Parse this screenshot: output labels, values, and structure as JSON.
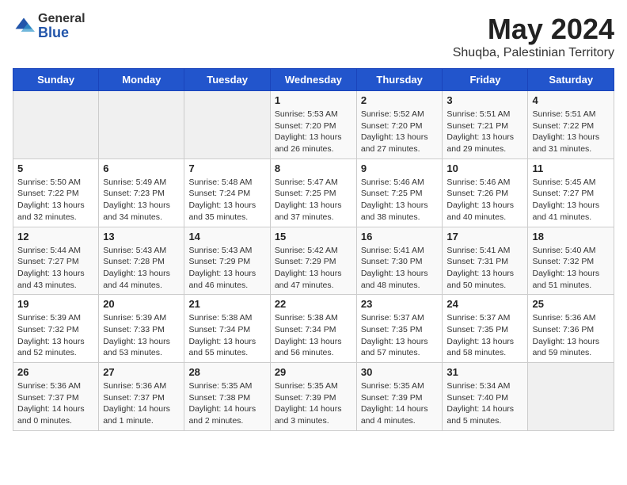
{
  "logo": {
    "general": "General",
    "blue": "Blue"
  },
  "title": "May 2024",
  "subtitle": "Shuqba, Palestinian Territory",
  "weekdays": [
    "Sunday",
    "Monday",
    "Tuesday",
    "Wednesday",
    "Thursday",
    "Friday",
    "Saturday"
  ],
  "weeks": [
    [
      null,
      null,
      null,
      {
        "day": "1",
        "sunrise": "Sunrise: 5:53 AM",
        "sunset": "Sunset: 7:20 PM",
        "daylight": "Daylight: 13 hours and 26 minutes."
      },
      {
        "day": "2",
        "sunrise": "Sunrise: 5:52 AM",
        "sunset": "Sunset: 7:20 PM",
        "daylight": "Daylight: 13 hours and 27 minutes."
      },
      {
        "day": "3",
        "sunrise": "Sunrise: 5:51 AM",
        "sunset": "Sunset: 7:21 PM",
        "daylight": "Daylight: 13 hours and 29 minutes."
      },
      {
        "day": "4",
        "sunrise": "Sunrise: 5:51 AM",
        "sunset": "Sunset: 7:22 PM",
        "daylight": "Daylight: 13 hours and 31 minutes."
      }
    ],
    [
      {
        "day": "5",
        "sunrise": "Sunrise: 5:50 AM",
        "sunset": "Sunset: 7:22 PM",
        "daylight": "Daylight: 13 hours and 32 minutes."
      },
      {
        "day": "6",
        "sunrise": "Sunrise: 5:49 AM",
        "sunset": "Sunset: 7:23 PM",
        "daylight": "Daylight: 13 hours and 34 minutes."
      },
      {
        "day": "7",
        "sunrise": "Sunrise: 5:48 AM",
        "sunset": "Sunset: 7:24 PM",
        "daylight": "Daylight: 13 hours and 35 minutes."
      },
      {
        "day": "8",
        "sunrise": "Sunrise: 5:47 AM",
        "sunset": "Sunset: 7:25 PM",
        "daylight": "Daylight: 13 hours and 37 minutes."
      },
      {
        "day": "9",
        "sunrise": "Sunrise: 5:46 AM",
        "sunset": "Sunset: 7:25 PM",
        "daylight": "Daylight: 13 hours and 38 minutes."
      },
      {
        "day": "10",
        "sunrise": "Sunrise: 5:46 AM",
        "sunset": "Sunset: 7:26 PM",
        "daylight": "Daylight: 13 hours and 40 minutes."
      },
      {
        "day": "11",
        "sunrise": "Sunrise: 5:45 AM",
        "sunset": "Sunset: 7:27 PM",
        "daylight": "Daylight: 13 hours and 41 minutes."
      }
    ],
    [
      {
        "day": "12",
        "sunrise": "Sunrise: 5:44 AM",
        "sunset": "Sunset: 7:27 PM",
        "daylight": "Daylight: 13 hours and 43 minutes."
      },
      {
        "day": "13",
        "sunrise": "Sunrise: 5:43 AM",
        "sunset": "Sunset: 7:28 PM",
        "daylight": "Daylight: 13 hours and 44 minutes."
      },
      {
        "day": "14",
        "sunrise": "Sunrise: 5:43 AM",
        "sunset": "Sunset: 7:29 PM",
        "daylight": "Daylight: 13 hours and 46 minutes."
      },
      {
        "day": "15",
        "sunrise": "Sunrise: 5:42 AM",
        "sunset": "Sunset: 7:29 PM",
        "daylight": "Daylight: 13 hours and 47 minutes."
      },
      {
        "day": "16",
        "sunrise": "Sunrise: 5:41 AM",
        "sunset": "Sunset: 7:30 PM",
        "daylight": "Daylight: 13 hours and 48 minutes."
      },
      {
        "day": "17",
        "sunrise": "Sunrise: 5:41 AM",
        "sunset": "Sunset: 7:31 PM",
        "daylight": "Daylight: 13 hours and 50 minutes."
      },
      {
        "day": "18",
        "sunrise": "Sunrise: 5:40 AM",
        "sunset": "Sunset: 7:32 PM",
        "daylight": "Daylight: 13 hours and 51 minutes."
      }
    ],
    [
      {
        "day": "19",
        "sunrise": "Sunrise: 5:39 AM",
        "sunset": "Sunset: 7:32 PM",
        "daylight": "Daylight: 13 hours and 52 minutes."
      },
      {
        "day": "20",
        "sunrise": "Sunrise: 5:39 AM",
        "sunset": "Sunset: 7:33 PM",
        "daylight": "Daylight: 13 hours and 53 minutes."
      },
      {
        "day": "21",
        "sunrise": "Sunrise: 5:38 AM",
        "sunset": "Sunset: 7:34 PM",
        "daylight": "Daylight: 13 hours and 55 minutes."
      },
      {
        "day": "22",
        "sunrise": "Sunrise: 5:38 AM",
        "sunset": "Sunset: 7:34 PM",
        "daylight": "Daylight: 13 hours and 56 minutes."
      },
      {
        "day": "23",
        "sunrise": "Sunrise: 5:37 AM",
        "sunset": "Sunset: 7:35 PM",
        "daylight": "Daylight: 13 hours and 57 minutes."
      },
      {
        "day": "24",
        "sunrise": "Sunrise: 5:37 AM",
        "sunset": "Sunset: 7:35 PM",
        "daylight": "Daylight: 13 hours and 58 minutes."
      },
      {
        "day": "25",
        "sunrise": "Sunrise: 5:36 AM",
        "sunset": "Sunset: 7:36 PM",
        "daylight": "Daylight: 13 hours and 59 minutes."
      }
    ],
    [
      {
        "day": "26",
        "sunrise": "Sunrise: 5:36 AM",
        "sunset": "Sunset: 7:37 PM",
        "daylight": "Daylight: 14 hours and 0 minutes."
      },
      {
        "day": "27",
        "sunrise": "Sunrise: 5:36 AM",
        "sunset": "Sunset: 7:37 PM",
        "daylight": "Daylight: 14 hours and 1 minute."
      },
      {
        "day": "28",
        "sunrise": "Sunrise: 5:35 AM",
        "sunset": "Sunset: 7:38 PM",
        "daylight": "Daylight: 14 hours and 2 minutes."
      },
      {
        "day": "29",
        "sunrise": "Sunrise: 5:35 AM",
        "sunset": "Sunset: 7:39 PM",
        "daylight": "Daylight: 14 hours and 3 minutes."
      },
      {
        "day": "30",
        "sunrise": "Sunrise: 5:35 AM",
        "sunset": "Sunset: 7:39 PM",
        "daylight": "Daylight: 14 hours and 4 minutes."
      },
      {
        "day": "31",
        "sunrise": "Sunrise: 5:34 AM",
        "sunset": "Sunset: 7:40 PM",
        "daylight": "Daylight: 14 hours and 5 minutes."
      },
      null
    ]
  ]
}
